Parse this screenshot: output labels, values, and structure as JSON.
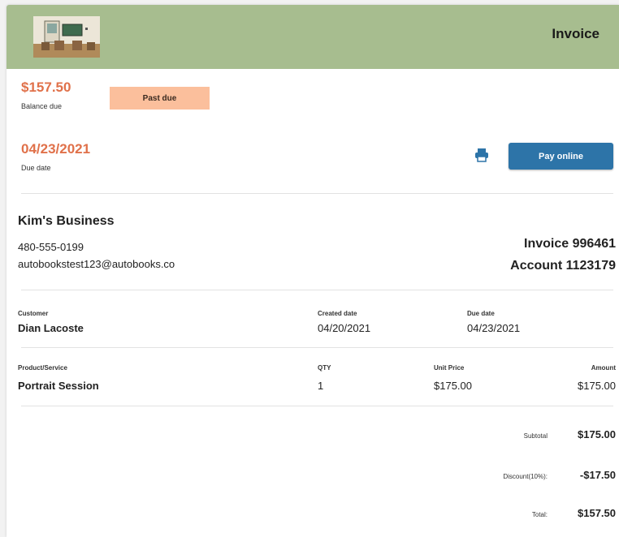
{
  "header": {
    "title": "Invoice"
  },
  "balance": {
    "amount": "$157.50",
    "label": "Balance due",
    "status": "Past due"
  },
  "due": {
    "date": "04/23/2021",
    "label": "Due date"
  },
  "actions": {
    "pay_label": "Pay online",
    "print_icon": "printer-icon"
  },
  "business": {
    "name": "Kim's Business",
    "phone": "480-555-0199",
    "email": "autobookstest123@autobooks.co",
    "invoice": "Invoice 996461",
    "account": "Account 1123179"
  },
  "customer": {
    "customer_label": "Customer",
    "customer_value": "Dian Lacoste",
    "created_label": "Created date",
    "created_value": "04/20/2021",
    "due_label": "Due date",
    "due_value": "04/23/2021"
  },
  "items": {
    "headers": [
      "Product/Service",
      "QTY",
      "Unit Price",
      "Amount"
    ],
    "rows": [
      [
        "Portrait Session",
        "1",
        "$175.00",
        "$175.00"
      ]
    ]
  },
  "totals": {
    "subtotal_label": "Subtotal",
    "subtotal_value": "$175.00",
    "discount_label": "Discount(10%):",
    "discount_value": "-$17.50",
    "total_label": "Total:",
    "total_value": "$157.50"
  },
  "colors": {
    "header": "#a7bd8f",
    "accent": "#e0714a",
    "badge": "#fbbf9c",
    "button": "#2d74a8"
  }
}
